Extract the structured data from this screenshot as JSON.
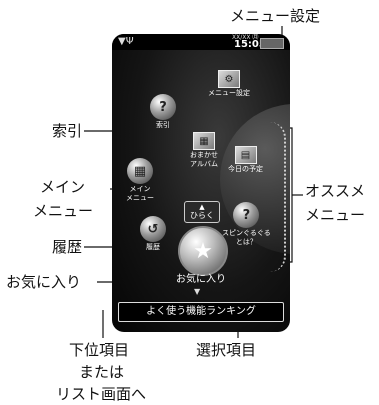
{
  "callouts": {
    "menu_settings": "メニュー設定",
    "index": "索引",
    "main_menu_1": "メイン",
    "main_menu_2": "メニュー",
    "history": "履歴",
    "favorites": "お気に入り",
    "recommended_1": "オススメ",
    "recommended_2": "メニュー",
    "lower_1": "下位項目",
    "lower_2": "または",
    "lower_3": "リスト画面へ",
    "selected": "選択項目"
  },
  "status_bar": {
    "antenna": "▼Ψ",
    "date": "XX/XX ㈪",
    "time": "15:05"
  },
  "screen": {
    "index_label": "索引",
    "index_glyph": "?",
    "settings_label": "メニュー設定",
    "main_menu_label_1": "メイン",
    "main_menu_label_2": "メニュー",
    "history_label": "履歴",
    "omakase_1": "おまかせ",
    "omakase_2": "アルバム",
    "today_label": "今日の予定",
    "spin_1": "スピンぐるぐる",
    "spin_2": "とは？",
    "spin_glyph": "?",
    "hiraku_arrow": "▲",
    "hiraku_label": "ひらく",
    "selected_glyph": "★",
    "favorites_label": "お気に入り",
    "down_arrow": "▼",
    "ranking_label": "よく使う機能ランキング"
  }
}
